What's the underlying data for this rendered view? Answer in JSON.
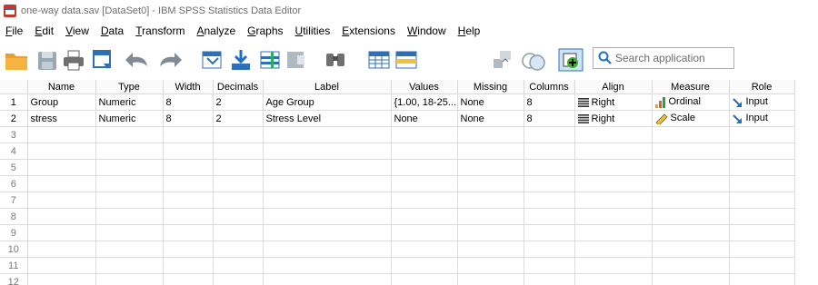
{
  "window": {
    "title": "one-way data.sav [DataSet0] - IBM SPSS Statistics Data Editor"
  },
  "menu": [
    {
      "first": "F",
      "rest": "ile"
    },
    {
      "first": "E",
      "rest": "dit"
    },
    {
      "first": "V",
      "rest": "iew"
    },
    {
      "first": "D",
      "rest": "ata"
    },
    {
      "first": "T",
      "rest": "ransform"
    },
    {
      "first": "A",
      "rest": "nalyze"
    },
    {
      "first": "G",
      "rest": "raphs"
    },
    {
      "first": "U",
      "rest": "tilities"
    },
    {
      "first": "E",
      "rest": "xtensions"
    },
    {
      "first": "W",
      "rest": "indow"
    },
    {
      "first": "H",
      "rest": "elp"
    }
  ],
  "search": {
    "placeholder": "Search application"
  },
  "columns": [
    "Name",
    "Type",
    "Width",
    "Decimals",
    "Label",
    "Values",
    "Missing",
    "Columns",
    "Align",
    "Measure",
    "Role"
  ],
  "variables": [
    {
      "row": "1",
      "name": "Group",
      "type": "Numeric",
      "width": "8",
      "decimals": "2",
      "label": "Age Group",
      "values": "{1.00, 18-25...",
      "missing": "None",
      "columns": "8",
      "align": "Right",
      "measure": "Ordinal",
      "role": "Input"
    },
    {
      "row": "2",
      "name": "stress",
      "type": "Numeric",
      "width": "8",
      "decimals": "2",
      "label": "Stress Level",
      "values": "None",
      "missing": "None",
      "columns": "8",
      "align": "Right",
      "measure": "Scale",
      "role": "Input"
    }
  ],
  "empty_rows": [
    "3",
    "4",
    "5",
    "6",
    "7",
    "8",
    "9",
    "10",
    "11",
    "12"
  ],
  "colors": {
    "accent_blue": "#1f6fc5",
    "folder_orange": "#f0a030",
    "grid_line": "#dcdcdc"
  }
}
